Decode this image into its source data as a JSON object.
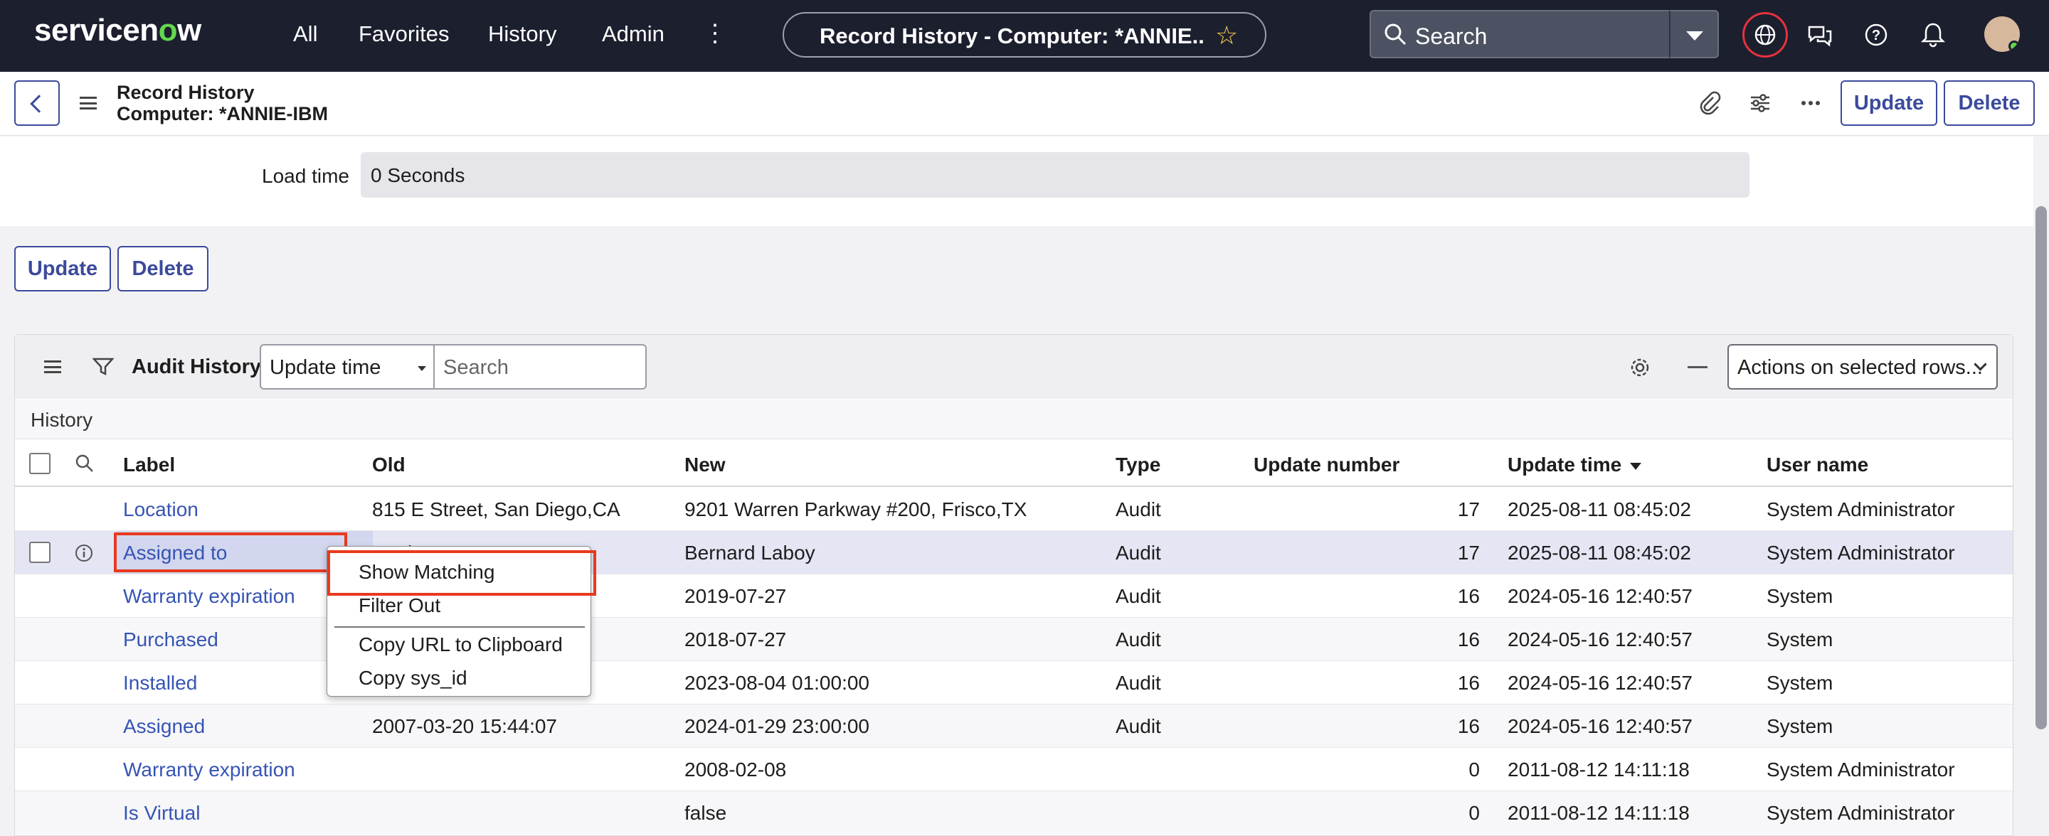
{
  "nav": {
    "logo_prefix": "servicen",
    "logo_o": "o",
    "logo_suffix": "w",
    "links": [
      "All",
      "Favorites",
      "History",
      "Admin"
    ],
    "record_title": "Record History - Computer: *ANNIE...",
    "search_placeholder": "Search"
  },
  "form": {
    "title_line1": "Record History",
    "title_line2": "Computer: *ANNIE-IBM",
    "update_label": "Update",
    "delete_label": "Delete",
    "load_time_label": "Load time",
    "load_time_value": "0 Seconds"
  },
  "list": {
    "title": "Audit History",
    "sort_field": "Update time",
    "search_placeholder": "Search",
    "actions_label": "Actions on selected rows...",
    "breadcrumb": "History",
    "columns": [
      "Label",
      "Old",
      "New",
      "Type",
      "Update number",
      "Update time",
      "User name"
    ],
    "rows": [
      {
        "label": "Location",
        "old": "815 E Street, San Diego,CA",
        "new": "9201 Warren Parkway #200, Frisco,TX",
        "type": "Audit",
        "update_number": "17",
        "update_time": "2025-08-11 08:45:02",
        "user": "System Administrator"
      },
      {
        "label": "Assigned to",
        "old": "Annie Approver",
        "new": "Bernard Laboy",
        "type": "Audit",
        "update_number": "17",
        "update_time": "2025-08-11 08:45:02",
        "user": "System Administrator"
      },
      {
        "label": "Warranty expiration",
        "old": "",
        "new": "2019-07-27",
        "type": "Audit",
        "update_number": "16",
        "update_time": "2024-05-16 12:40:57",
        "user": "System"
      },
      {
        "label": "Purchased",
        "old": "",
        "new": "2018-07-27",
        "type": "Audit",
        "update_number": "16",
        "update_time": "2024-05-16 12:40:57",
        "user": "System"
      },
      {
        "label": "Installed",
        "old": "",
        "new": "2023-08-04 01:00:00",
        "type": "Audit",
        "update_number": "16",
        "update_time": "2024-05-16 12:40:57",
        "user": "System"
      },
      {
        "label": "Assigned",
        "old": "2007-03-20 15:44:07",
        "new": "2024-01-29 23:00:00",
        "type": "Audit",
        "update_number": "16",
        "update_time": "2024-05-16 12:40:57",
        "user": "System"
      },
      {
        "label": "Warranty expiration",
        "old": "",
        "new": "2008-02-08",
        "type": "",
        "update_number": "0",
        "update_time": "2011-08-12 14:11:18",
        "user": "System Administrator"
      },
      {
        "label": "Is Virtual",
        "old": "",
        "new": "false",
        "type": "",
        "update_number": "0",
        "update_time": "2011-08-12 14:11:18",
        "user": "System Administrator"
      }
    ]
  },
  "context_menu": {
    "items": [
      "Show Matching",
      "Filter Out",
      "Copy URL to Clipboard",
      "Copy sys_id"
    ]
  },
  "colors": {
    "nav_bg": "#1c1f2e",
    "accent": "#3b4a9c",
    "link": "#3654b4",
    "highlight": "#e8391e",
    "selected_row": "#e4e6f4"
  }
}
